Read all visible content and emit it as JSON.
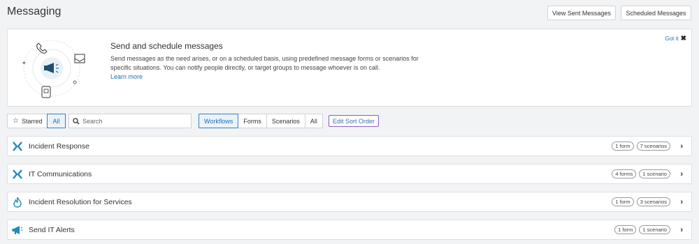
{
  "header": {
    "title": "Messaging",
    "view_sent_label": "View Sent Messages",
    "scheduled_label": "Scheduled Messages"
  },
  "banner": {
    "title": "Send and schedule messages",
    "text": "Send messages as the need arises, or on a scheduled basis, using predefined message forms or scenarios for specific situations. You can notify people directly, or target groups to message whoever is on call.",
    "link": "Learn more",
    "got_it": "Got it"
  },
  "filters": {
    "starred": "Starred",
    "all": "All",
    "search_placeholder": "Search",
    "type_tabs": [
      "Workflows",
      "Forms",
      "Scenarios",
      "All"
    ],
    "active_type": "Workflows",
    "edit_sort": "Edit Sort Order"
  },
  "workflows": [
    {
      "title": "Incident Response",
      "icon": "workflow-x-icon",
      "badges": [
        "1 form",
        "7 scenarios"
      ]
    },
    {
      "title": "IT Communications",
      "icon": "workflow-x-icon",
      "badges": [
        "4 forms",
        "1 scenario"
      ]
    },
    {
      "title": "Incident Resolution for Services",
      "icon": "flame-icon",
      "badges": [
        "1 form",
        "3 scenarios"
      ]
    },
    {
      "title": "Send IT Alerts",
      "icon": "megaphone-icon",
      "badges": [
        "1 form",
        "1 scenario"
      ]
    }
  ],
  "colors": {
    "accent": "#1a73b5",
    "icon_teal": "#1f8bb8",
    "highlight_border": "#8e59c9"
  }
}
